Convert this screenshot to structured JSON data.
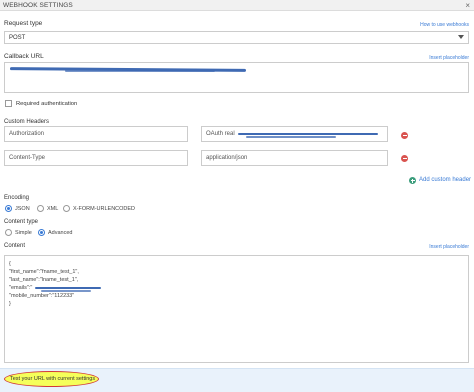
{
  "window": {
    "title": "WEBHOOK SETTINGS",
    "close": "×"
  },
  "request_type": {
    "label": "Request type",
    "help_link": "How to use webhooks",
    "value": "POST"
  },
  "callback_url": {
    "label": "Callback URL",
    "insert_link": "Insert placeholder"
  },
  "auth": {
    "label": "Required authentication",
    "checked": false
  },
  "custom_headers": {
    "label": "Custom Headers",
    "rows": [
      {
        "name": "Authorization",
        "value": "OAuth real"
      },
      {
        "name": "Content-Type",
        "value": "application/json"
      }
    ],
    "add_label": "Add custom header"
  },
  "encoding": {
    "label": "Encoding",
    "options": [
      {
        "label": "JSON",
        "selected": true
      },
      {
        "label": "XML",
        "selected": false
      },
      {
        "label": "X-FORM-URLENCODED",
        "selected": false
      }
    ]
  },
  "content_type": {
    "label": "Content type",
    "options": [
      {
        "label": "Simple",
        "selected": false
      },
      {
        "label": "Advanced",
        "selected": true
      }
    ]
  },
  "content": {
    "label": "Content",
    "insert_link": "Insert placeholder",
    "lines": [
      "{",
      "\"first_name\":\"fname_test_1\",",
      "\"last_name\":\"lname_test_1\",",
      "\"emails\":\"",
      "\"mobile_number\":\"112233\"",
      "}"
    ]
  },
  "test_button": "Test your URL with current settings",
  "colors": {
    "link": "#3a7bd5",
    "remove": "#d9534f",
    "add": "#3c9d7c",
    "highlight": "#f5ff5a",
    "footer": "#e9f2fb"
  }
}
